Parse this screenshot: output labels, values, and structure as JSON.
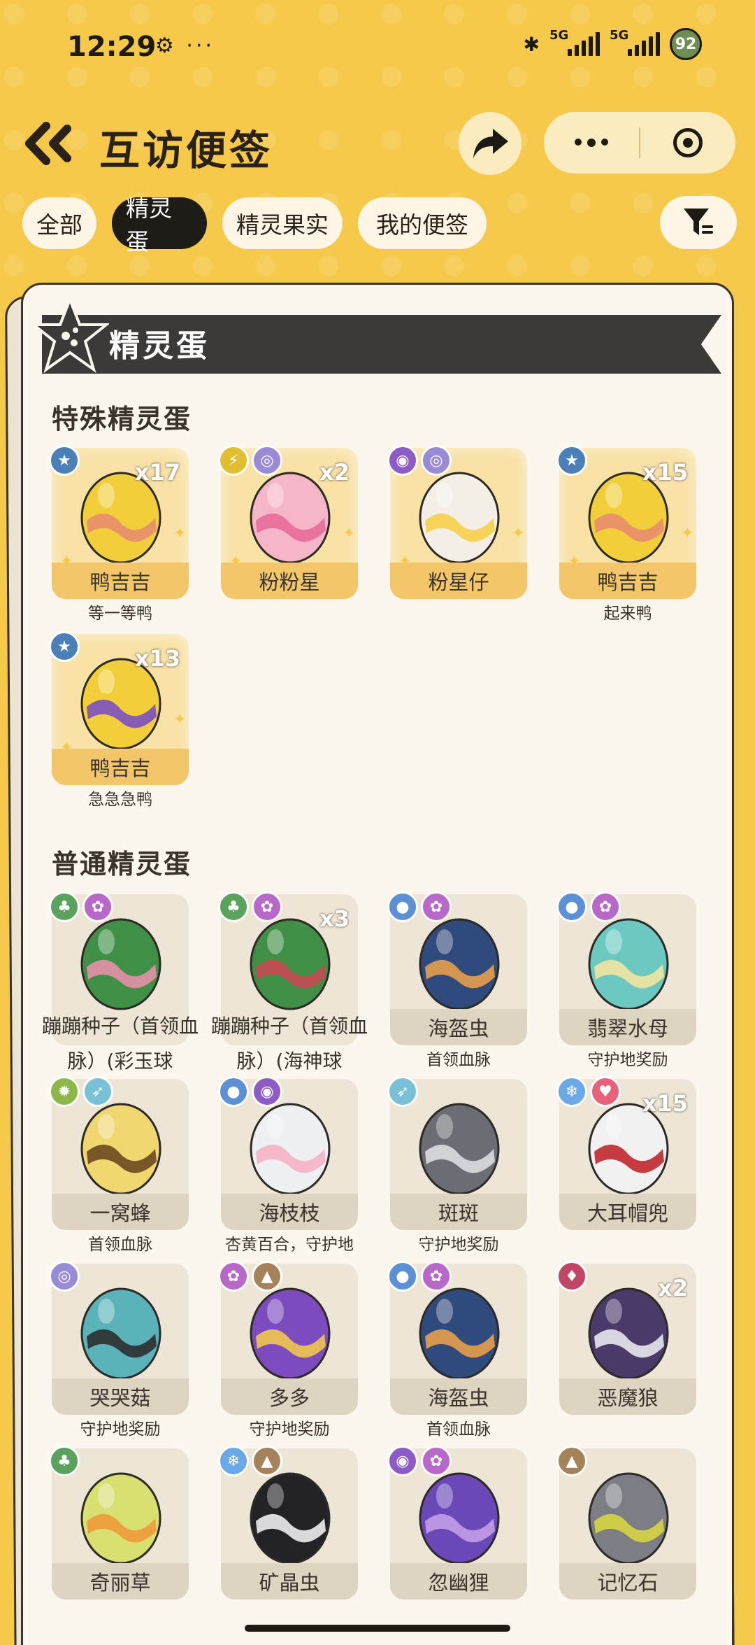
{
  "status_bar": {
    "time": "12:29",
    "left_icons": "⚙ ···",
    "net1": "5G",
    "net2": "5G",
    "battery": "92"
  },
  "header": {
    "title": "互访便签"
  },
  "tabs": [
    {
      "label": "全部"
    },
    {
      "label": "精灵蛋"
    },
    {
      "label": "精灵果实"
    },
    {
      "label": "我的便签"
    }
  ],
  "active_tab": "精灵蛋",
  "section": {
    "title": "精灵蛋"
  },
  "special": {
    "title": "特殊精灵蛋",
    "items": [
      {
        "name": "鸭吉吉",
        "count": "x17",
        "caption": "等一等鸭",
        "types": [
          "star"
        ]
      },
      {
        "name": "粉粉星",
        "count": "x2",
        "caption": "",
        "types": [
          "electric",
          "psychic"
        ]
      },
      {
        "name": "粉星仔",
        "count": "",
        "caption": "",
        "types": [
          "ghost",
          "psychic"
        ]
      },
      {
        "name": "鸭吉吉",
        "count": "x15",
        "caption": "起来鸭",
        "types": [
          "star"
        ]
      },
      {
        "name": "鸭吉吉",
        "count": "x13",
        "caption": "急急急鸭",
        "types": [
          "star"
        ]
      }
    ]
  },
  "normal": {
    "title": "普通精灵蛋",
    "items": [
      {
        "name": "蹦蹦种子（首领血脉）(彩玉球",
        "count": "",
        "caption": "",
        "types": [
          "grass",
          "fairy"
        ]
      },
      {
        "name": "蹦蹦种子（首领血脉）(海神球",
        "count": "x3",
        "caption": "",
        "types": [
          "grass",
          "fairy"
        ]
      },
      {
        "name": "海盔虫",
        "count": "",
        "caption": "首领血脉",
        "types": [
          "water",
          "fairy"
        ]
      },
      {
        "name": "翡翠水母",
        "count": "",
        "caption": "守护地奖励",
        "types": [
          "water",
          "fairy"
        ]
      },
      {
        "name": "一窝蜂",
        "count": "",
        "caption": "首领血脉",
        "types": [
          "bug",
          "flying"
        ]
      },
      {
        "name": "海枝枝",
        "count": "",
        "caption": "杏黄百合，守护地",
        "types": [
          "water",
          "ghost"
        ]
      },
      {
        "name": "斑斑",
        "count": "",
        "caption": "守护地奖励",
        "types": [
          "flying"
        ]
      },
      {
        "name": "大耳帽兜",
        "count": "x15",
        "caption": "",
        "types": [
          "ice",
          "heart"
        ]
      },
      {
        "name": "哭哭菇",
        "count": "",
        "caption": "守护地奖励",
        "types": [
          "psychic"
        ]
      },
      {
        "name": "多多",
        "count": "",
        "caption": "守护地奖励",
        "types": [
          "fairy",
          "ground"
        ]
      },
      {
        "name": "海盔虫",
        "count": "",
        "caption": "首领血脉",
        "types": [
          "water",
          "fairy"
        ]
      },
      {
        "name": "恶魔狼",
        "count": "x2",
        "caption": "",
        "types": [
          "demon"
        ]
      },
      {
        "name": "奇丽草",
        "count": "",
        "caption": "",
        "types": [
          "grass"
        ]
      },
      {
        "name": "矿晶虫",
        "count": "",
        "caption": "",
        "types": [
          "ice",
          "ground"
        ]
      },
      {
        "name": "忽幽狸",
        "count": "",
        "caption": "",
        "types": [
          "ghost",
          "fairy"
        ]
      },
      {
        "name": "记忆石",
        "count": "",
        "caption": "",
        "types": [
          "ground"
        ]
      }
    ]
  },
  "icons": {
    "back": "double-chevron-left-icon",
    "share": "share-arrow-icon",
    "more": "more-dots-icon",
    "close": "target-close-icon",
    "filter": "filter-icon",
    "banner": "star-badge-icon"
  },
  "colors": {
    "background": "#f6c94a",
    "tab_active": "#1f1b16",
    "special_card": "#f8e2a6",
    "special_namebar": "#f3c769",
    "normal_card": "#ede6d7",
    "type_grass": "#5aa35c",
    "type_fairy": "#b768c9",
    "type_water": "#5b8fd6",
    "type_star": "#4a7fb8",
    "type_psychic": "#9a8bd6",
    "type_electric": "#e0c030",
    "type_ghost": "#8c5bc7",
    "type_bug": "#8cb848",
    "type_flying": "#79c1d6",
    "type_ice": "#6aa8e8",
    "type_heart": "#e8607a",
    "type_ground": "#a5825a",
    "type_demon": "#c14565"
  }
}
